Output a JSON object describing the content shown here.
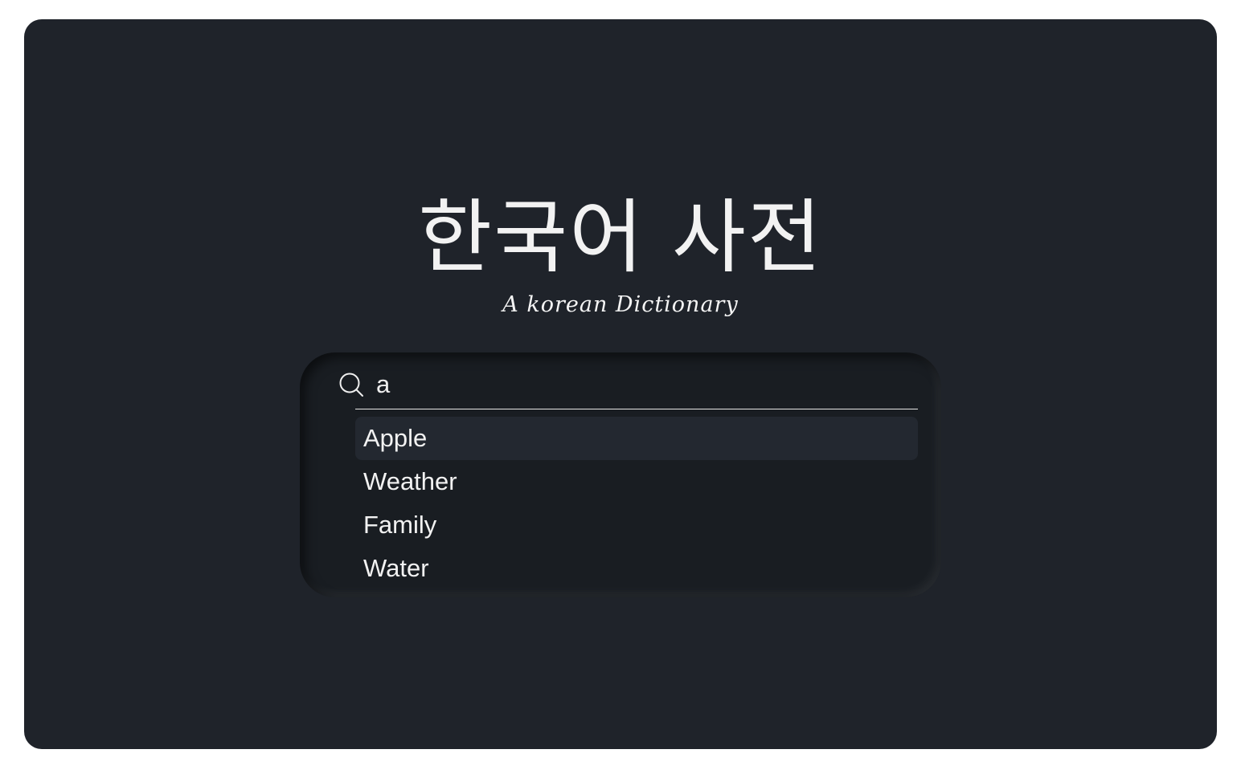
{
  "app": {
    "title": "한국어 사전",
    "subtitle": "A korean Dictionary"
  },
  "search": {
    "icon": "search-icon",
    "value": "a",
    "suggestions": [
      {
        "label": "Apple",
        "active": true
      },
      {
        "label": "Weather",
        "active": false
      },
      {
        "label": "Family",
        "active": false
      },
      {
        "label": "Water",
        "active": false
      }
    ]
  },
  "colors": {
    "frame_background": "#1f232a",
    "panel_background": "#191d22",
    "active_suggestion": "#232830",
    "text": "#f2f2f2"
  }
}
